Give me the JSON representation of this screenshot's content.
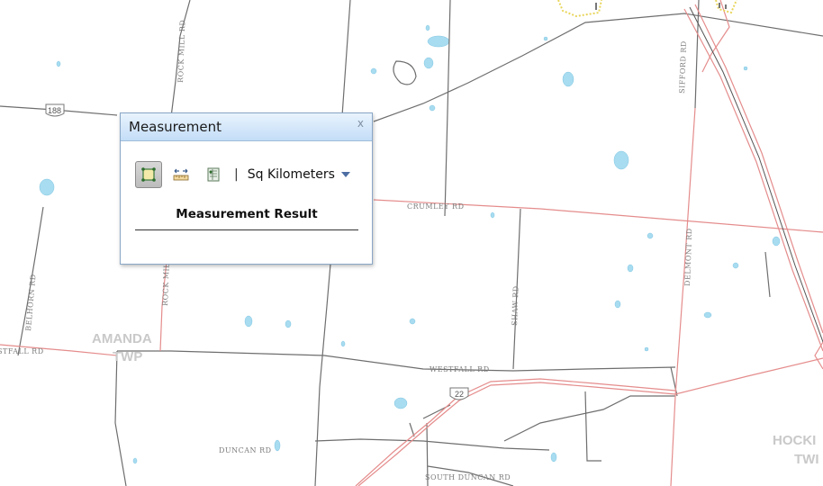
{
  "map": {
    "road_labels": {
      "rock_mill_rd": "ROCK MILL RD",
      "crumley_rd": "CRUMLEY RD",
      "shaw_rd": "SHAW RD",
      "delmont_rd": "DELMONT RD",
      "sifford_rd": "SIFFORD RD",
      "belhorn_rd": "BELHORN RD",
      "westfall_rd": "WESTFALL RD",
      "westfall_rd_west": "WESTFALL RD",
      "duncan_rd": "DUNCAN RD",
      "south_duncan_rd": "SOUTH DUNCAN RD"
    },
    "area_labels": {
      "amanda_line1": "AMANDA",
      "amanda_line2": "TWP",
      "hocking_line1": "HOCKI",
      "hocking_line2": "TWI"
    },
    "shields": {
      "route_188": "188",
      "us_22": "22"
    }
  },
  "measurement": {
    "title": "Measurement",
    "close_label": "x",
    "separator": "|",
    "unit_selected": "Sq Kilometers",
    "result_title": "Measurement Result"
  },
  "colors": {
    "road_minor": "#6e6e6e",
    "road_major": "#e58c8c",
    "water": "#a8dcf0",
    "window_border": "#8aa7c7"
  }
}
